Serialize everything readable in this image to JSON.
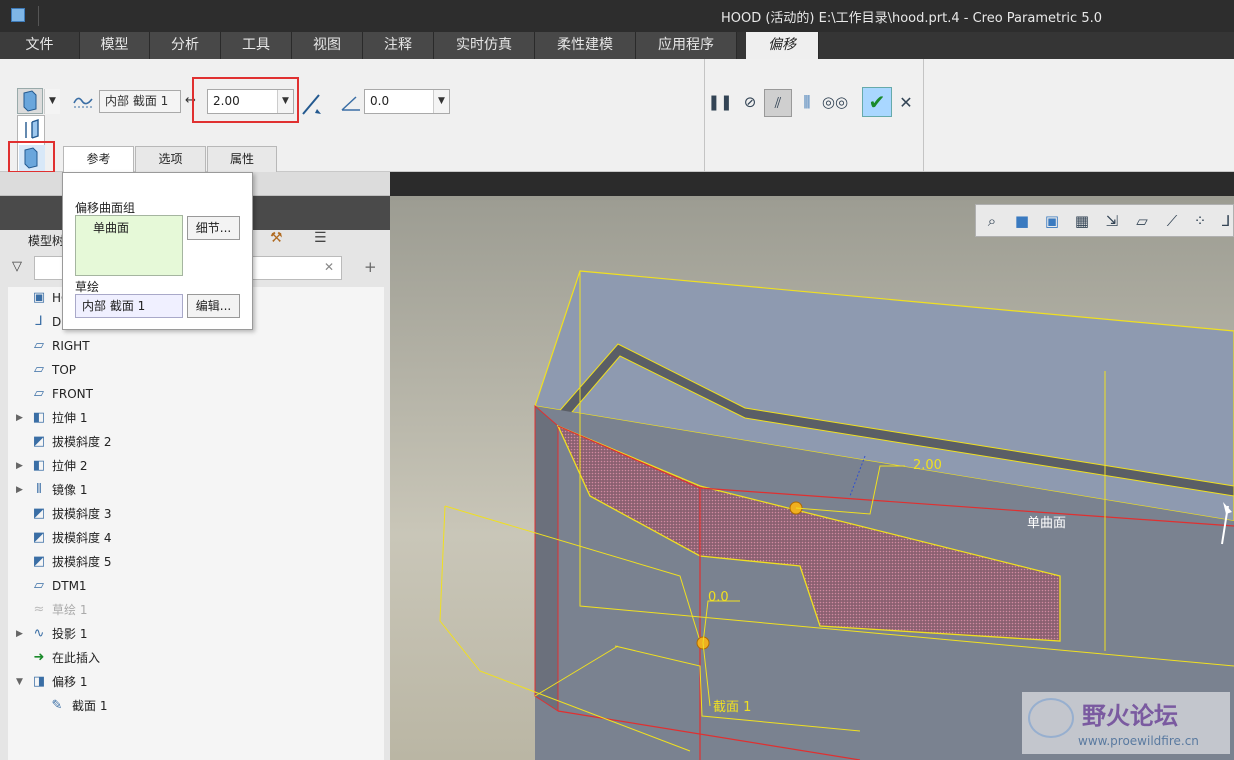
{
  "window": {
    "title": "HOOD (活动的) E:\\工作目录\\hood.prt.4 - Creo Parametric 5.0"
  },
  "menu": {
    "tabs": [
      "文件",
      "模型",
      "分析",
      "工具",
      "视图",
      "注释",
      "实时仿真",
      "柔性建模",
      "应用程序",
      "偏移"
    ],
    "active": "偏移"
  },
  "ribbon": {
    "sketch_field": "内部 截面 1",
    "offset_value": "2.00",
    "angle_value": "0.0",
    "subtabs": [
      "参考",
      "选项",
      "属性"
    ],
    "active_subtab": "参考"
  },
  "popup": {
    "surface_group_label": "偏移曲面组",
    "surface_item": "单曲面",
    "details_button": "细节...",
    "sketch_label": "草绘",
    "sketch_value": "内部 截面 1",
    "edit_button": "编辑..."
  },
  "model_tree": {
    "header": "模型树",
    "items": [
      {
        "label": "HOOD",
        "icon": "part-icon",
        "arrow": ""
      },
      {
        "label": "D",
        "icon": "csys-icon",
        "arrow": ""
      },
      {
        "label": "RIGHT",
        "icon": "datum-plane-icon",
        "arrow": ""
      },
      {
        "label": "TOP",
        "icon": "datum-plane-icon",
        "arrow": ""
      },
      {
        "label": "FRONT",
        "icon": "datum-plane-icon",
        "arrow": ""
      },
      {
        "label": "拉伸 1",
        "icon": "extrude-icon",
        "arrow": "▶"
      },
      {
        "label": "拔模斜度 2",
        "icon": "draft-icon",
        "arrow": ""
      },
      {
        "label": "拉伸 2",
        "icon": "extrude-icon",
        "arrow": "▶"
      },
      {
        "label": "镜像 1",
        "icon": "mirror-icon",
        "arrow": "▶"
      },
      {
        "label": "拔模斜度 3",
        "icon": "draft-icon",
        "arrow": ""
      },
      {
        "label": "拔模斜度 4",
        "icon": "draft-icon",
        "arrow": ""
      },
      {
        "label": "拔模斜度 5",
        "icon": "draft-icon",
        "arrow": ""
      },
      {
        "label": "DTM1",
        "icon": "datum-plane-icon",
        "arrow": ""
      },
      {
        "label": "草绘 1",
        "icon": "sketch-icon",
        "arrow": ""
      },
      {
        "label": "投影 1",
        "icon": "projection-icon",
        "arrow": "▶"
      },
      {
        "label": "在此插入",
        "icon": "insert-here-icon",
        "arrow": ""
      },
      {
        "label": "偏移 1",
        "icon": "offset-icon",
        "arrow": "▼"
      },
      {
        "label": "截面 1",
        "icon": "section-icon",
        "arrow": ""
      }
    ]
  },
  "viewport": {
    "dim_offset": "2.00",
    "dim_angle": "0.0",
    "surface_label": "单曲面",
    "section_label": "截面 1",
    "watermark_cn": "野火论坛",
    "watermark_url": "www.proewildfire.cn"
  },
  "colors": {
    "accent_red": "#e03030",
    "highlight_yellow": "#f0e020",
    "surface": "#7a8290"
  }
}
